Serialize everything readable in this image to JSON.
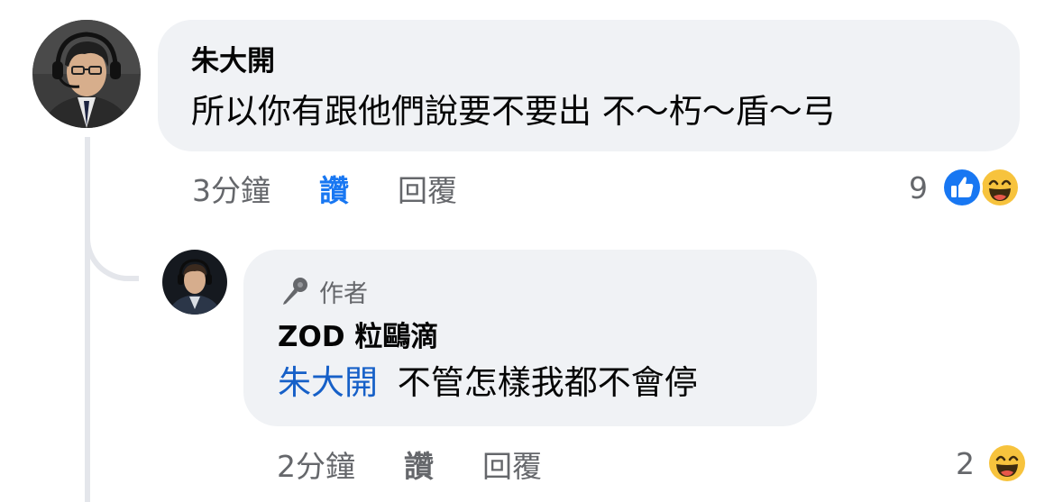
{
  "comment": {
    "author": "朱大開",
    "text": "所以你有跟他們說要不要出 不～朽～盾～弓",
    "time": "3分鐘",
    "like_label": "讚",
    "reply_label": "回覆",
    "reaction_count": "9",
    "reactions": [
      "like-icon",
      "haha-icon"
    ],
    "liked": true,
    "colors": {
      "like_active": "#1877f2",
      "bubble": "#f0f2f5",
      "meta": "#65676b"
    }
  },
  "reply": {
    "badge_label": "作者",
    "badge_icon": "microphone-icon",
    "author": "ZOD 粒鷗滴",
    "mention": "朱大開",
    "text": "不管怎樣我都不會停",
    "time": "2分鐘",
    "like_label": "讚",
    "reply_label": "回覆",
    "reaction_count": "2",
    "reactions": [
      "haha-icon"
    ],
    "colors": {
      "mention": "#1660c8"
    }
  }
}
